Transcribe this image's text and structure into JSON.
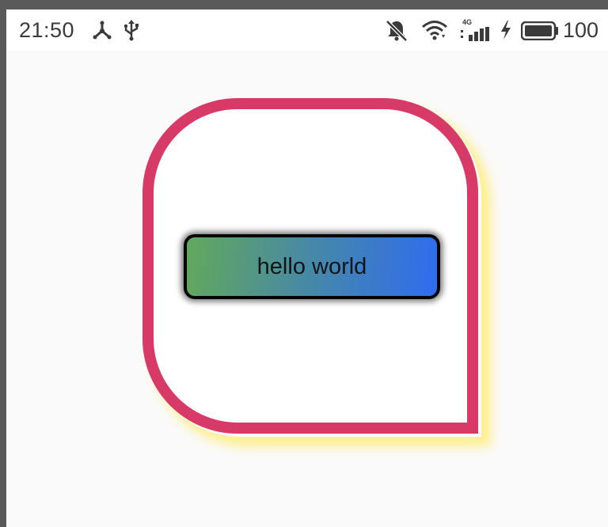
{
  "status_bar": {
    "time": "21:50",
    "left_icons": [
      "hub-icon",
      "usb-icon"
    ],
    "right_icons": [
      "notifications-off-icon",
      "wifi-icon",
      "signal-4g-icon",
      "charging-bolt-icon",
      "battery-icon"
    ],
    "network_type": "4G",
    "battery_percent": "100"
  },
  "card": {
    "border_color": "#d83a68",
    "shadow_color": "#fff176"
  },
  "button": {
    "label": "hello world",
    "gradient_start": "#63a85c",
    "gradient_end": "#2f6cf0"
  }
}
